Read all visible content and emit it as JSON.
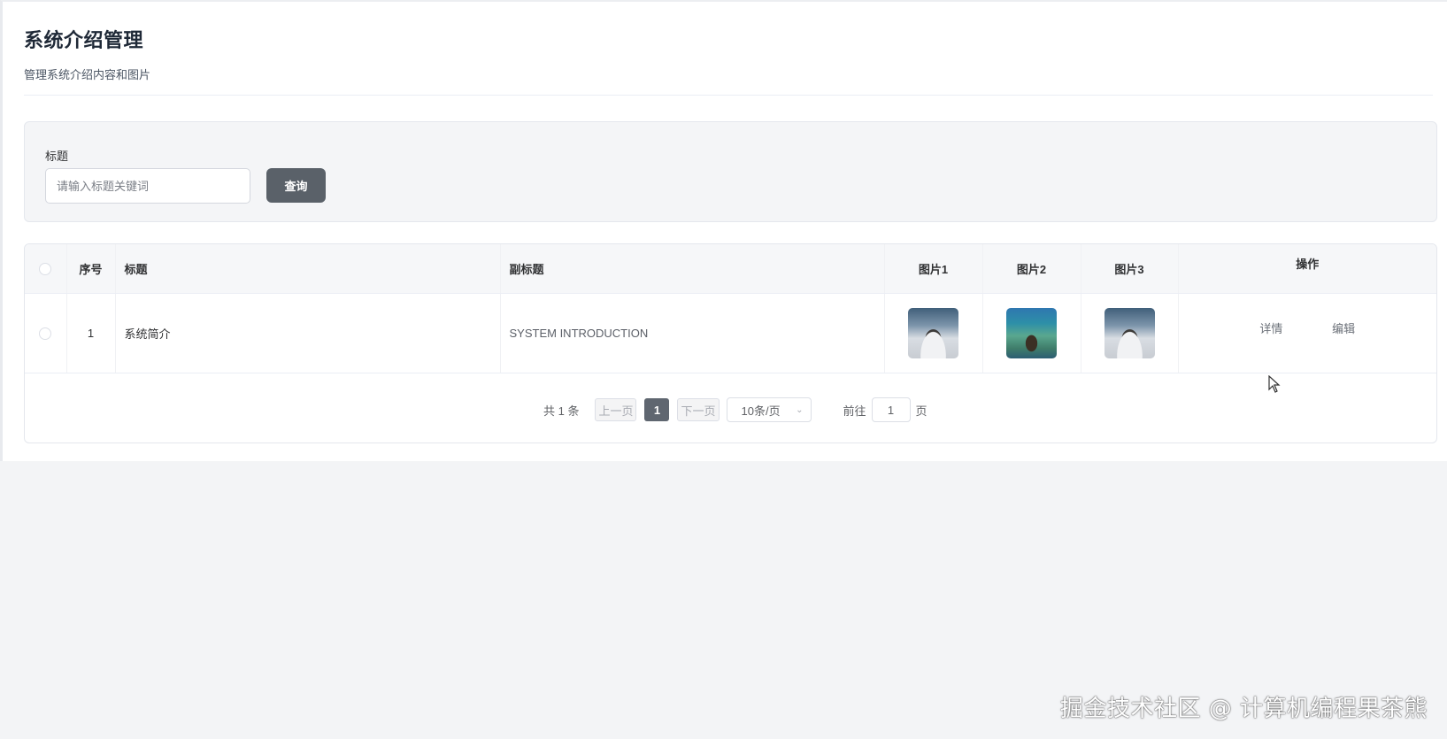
{
  "header": {
    "title": "系统介绍管理",
    "subtitle": "管理系统介绍内容和图片"
  },
  "search": {
    "label": "标题",
    "placeholder": "请输入标题关键词",
    "value": "",
    "button_label": "查询"
  },
  "table": {
    "columns": {
      "index": "序号",
      "title": "标题",
      "subtitle": "副标题",
      "image1": "图片1",
      "image2": "图片2",
      "image3": "图片3",
      "actions": "操作"
    },
    "rows": [
      {
        "index": "1",
        "title": "系统简介",
        "subtitle": "SYSTEM INTRODUCTION",
        "actions": {
          "detail": "详情",
          "edit": "编辑"
        }
      }
    ]
  },
  "pagination": {
    "total_text": "共 1 条",
    "prev_label": "上一页",
    "current_page": "1",
    "next_label": "下一页",
    "page_size": "10条/页",
    "goto_label": "前往",
    "goto_value": "1",
    "page_suffix": "页"
  },
  "watermark": "掘金技术社区 @ 计算机编程果茶熊",
  "colors": {
    "primary_button": "#5a6169",
    "active_page": "#5f6670",
    "page_background": "#f3f4f6"
  }
}
